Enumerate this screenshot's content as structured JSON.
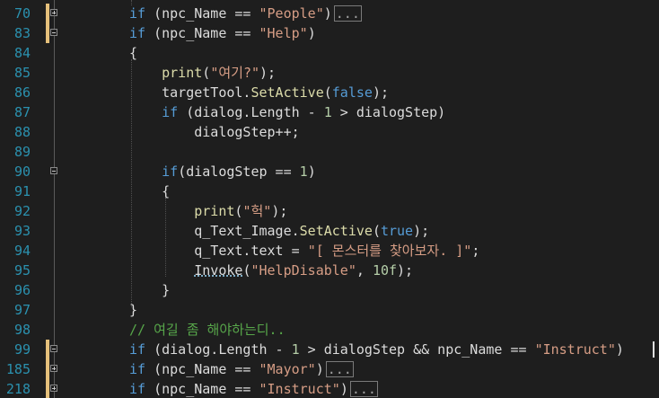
{
  "editor": {
    "line_numbers": [
      "70",
      "83",
      "84",
      "85",
      "86",
      "87",
      "88",
      "89",
      "90",
      "91",
      "92",
      "93",
      "94",
      "95",
      "96",
      "97",
      "98",
      "99",
      "185",
      "218"
    ],
    "lines": [
      [
        {
          "t": "if",
          "c": "kw"
        },
        {
          "t": " (npc_Name == ",
          "c": "id"
        },
        {
          "t": "\"People\"",
          "c": "str"
        },
        {
          "t": ")",
          "c": "id"
        },
        {
          "t": "...",
          "c": "ell"
        }
      ],
      [
        {
          "t": "if",
          "c": "kw"
        },
        {
          "t": " (npc_Name == ",
          "c": "id"
        },
        {
          "t": "\"Help\"",
          "c": "str"
        },
        {
          "t": ")",
          "c": "id"
        }
      ],
      [
        {
          "t": "{",
          "c": "id"
        }
      ],
      [
        {
          "t": "    ",
          "c": "id"
        },
        {
          "t": "print",
          "c": "mth"
        },
        {
          "t": "(",
          "c": "id"
        },
        {
          "t": "\"여기?\"",
          "c": "str"
        },
        {
          "t": ");",
          "c": "id"
        }
      ],
      [
        {
          "t": "    targetTool.",
          "c": "id"
        },
        {
          "t": "SetActive",
          "c": "mth"
        },
        {
          "t": "(",
          "c": "id"
        },
        {
          "t": "false",
          "c": "kw"
        },
        {
          "t": ");",
          "c": "id"
        }
      ],
      [
        {
          "t": "    ",
          "c": "id"
        },
        {
          "t": "if",
          "c": "kw"
        },
        {
          "t": " (dialog.Length - ",
          "c": "id"
        },
        {
          "t": "1",
          "c": "num"
        },
        {
          "t": " > dialogStep)",
          "c": "id"
        }
      ],
      [
        {
          "t": "        dialogStep++;",
          "c": "id"
        }
      ],
      [],
      [
        {
          "t": "    ",
          "c": "id"
        },
        {
          "t": "if",
          "c": "kw"
        },
        {
          "t": "(dialogStep == ",
          "c": "id"
        },
        {
          "t": "1",
          "c": "num"
        },
        {
          "t": ")",
          "c": "id"
        }
      ],
      [
        {
          "t": "    {",
          "c": "id"
        }
      ],
      [
        {
          "t": "        ",
          "c": "id"
        },
        {
          "t": "print",
          "c": "mth"
        },
        {
          "t": "(",
          "c": "id"
        },
        {
          "t": "\"헉\"",
          "c": "str"
        },
        {
          "t": ");",
          "c": "id"
        }
      ],
      [
        {
          "t": "        q_Text_Image.",
          "c": "id"
        },
        {
          "t": "SetActive",
          "c": "mth"
        },
        {
          "t": "(",
          "c": "id"
        },
        {
          "t": "true",
          "c": "kw"
        },
        {
          "t": ");",
          "c": "id"
        }
      ],
      [
        {
          "t": "        q_Text.text = ",
          "c": "id"
        },
        {
          "t": "\"[ 몬스터를 찾아보자. ]\"",
          "c": "str"
        },
        {
          "t": ";",
          "c": "id"
        }
      ],
      [
        {
          "t": "        ",
          "c": "id"
        },
        {
          "t": "Invoke",
          "c": "sq"
        },
        {
          "t": "(",
          "c": "id"
        },
        {
          "t": "\"HelpDisable\"",
          "c": "str"
        },
        {
          "t": ", ",
          "c": "id"
        },
        {
          "t": "10f",
          "c": "num"
        },
        {
          "t": ");",
          "c": "id"
        }
      ],
      [
        {
          "t": "    }",
          "c": "id"
        }
      ],
      [
        {
          "t": "}",
          "c": "id"
        }
      ],
      [
        {
          "t": "// 여길 좀 해야하는디..",
          "c": "cm"
        }
      ],
      [
        {
          "t": "if",
          "c": "kw"
        },
        {
          "t": " (dialog.Length - ",
          "c": "id"
        },
        {
          "t": "1",
          "c": "num"
        },
        {
          "t": " > dialogStep && npc_Name == ",
          "c": "id"
        },
        {
          "t": "\"Instruct\"",
          "c": "str"
        },
        {
          "t": ")",
          "c": "id"
        }
      ],
      [
        {
          "t": "if",
          "c": "kw"
        },
        {
          "t": " (npc_Name == ",
          "c": "id"
        },
        {
          "t": "\"Mayor\"",
          "c": "str"
        },
        {
          "t": ")",
          "c": "id"
        },
        {
          "t": "...",
          "c": "ell"
        }
      ],
      [
        {
          "t": "if",
          "c": "kw"
        },
        {
          "t": " (npc_Name == ",
          "c": "id"
        },
        {
          "t": "\"Instruct\"",
          "c": "str"
        },
        {
          "t": ")",
          "c": "id"
        },
        {
          "t": "...",
          "c": "ell"
        }
      ]
    ],
    "folds": {
      "0": "collapsed",
      "1": "open",
      "8": "open",
      "17": "open",
      "18": "collapsed",
      "19": "collapsed"
    },
    "changed_lines": [
      0,
      1,
      17,
      18,
      19
    ]
  }
}
